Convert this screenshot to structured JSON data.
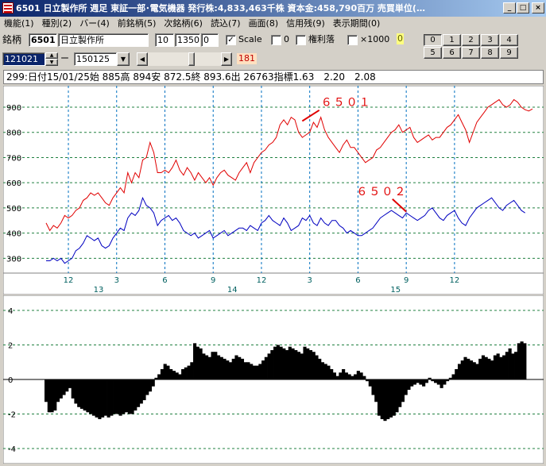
{
  "window": {
    "title": "6501 日立製作所 週足 東証一部･電気機器 発行株:4,833,463千株 資本金:458,790百万 売買単位(…",
    "min_glyph": "_",
    "max_glyph": "□",
    "close_glyph": "×"
  },
  "menu": [
    {
      "label": "機能(1)"
    },
    {
      "label": "種別(2)"
    },
    {
      "label": "バー(4)"
    },
    {
      "label": "前銘柄(5)"
    },
    {
      "label": "次銘柄(6)"
    },
    {
      "label": "読込(7)"
    },
    {
      "label": "画面(8)"
    },
    {
      "label": "信用残(9)"
    },
    {
      "label": "表示期間(0)"
    }
  ],
  "toolbar": {
    "code_label": "銘柄",
    "code": "6501",
    "name": "日立製作所",
    "param1": "10",
    "param2": "1350",
    "param3": "0",
    "scale_label": "Scale",
    "scale_checked": "✓",
    "zero_label": "0",
    "kenri_label": "権利落",
    "x1000_label": "×1000",
    "yellow_value": "0",
    "start_date": "121021",
    "dash": "ー",
    "end_date": "150125",
    "slider_value": "181",
    "num_buttons": [
      "0",
      "1",
      "2",
      "3",
      "4",
      "5",
      "6",
      "7",
      "8",
      "9"
    ],
    "selected_button": "0"
  },
  "info_line": "299:日付15/01/25始 885高 894安 872.5終 893.6出 26763指標1.63　2.20　2.08",
  "chart_data": [
    {
      "type": "line",
      "x_tick_labels": [
        "12",
        "3",
        "6",
        "9",
        "12",
        "3",
        "6",
        "9",
        "12"
      ],
      "year_labels": [
        "13",
        "14",
        "15"
      ],
      "y_ticks": [
        300,
        400,
        500,
        600,
        700,
        800,
        900
      ],
      "ylim": [
        260,
        960
      ],
      "grid": true,
      "series": [
        {
          "name": "6501",
          "color": "#e00000",
          "values": [
            440,
            410,
            430,
            420,
            440,
            470,
            460,
            470,
            490,
            500,
            530,
            540,
            560,
            550,
            560,
            540,
            520,
            510,
            540,
            560,
            580,
            560,
            640,
            600,
            640,
            620,
            690,
            700,
            760,
            720,
            640,
            640,
            650,
            640,
            660,
            690,
            650,
            630,
            660,
            640,
            610,
            640,
            620,
            600,
            620,
            590,
            620,
            640,
            650,
            630,
            620,
            610,
            640,
            660,
            680,
            640,
            680,
            700,
            720,
            730,
            750,
            760,
            780,
            830,
            850,
            830,
            860,
            850,
            800,
            780,
            790,
            800,
            840,
            820,
            860,
            810,
            780,
            760,
            740,
            720,
            750,
            770,
            740,
            740,
            720,
            700,
            680,
            690,
            700,
            730,
            740,
            760,
            780,
            800,
            810,
            830,
            800,
            810,
            820,
            780,
            760,
            770,
            780,
            790,
            770,
            780,
            780,
            800,
            820,
            830,
            850,
            870,
            840,
            810,
            760,
            800,
            840,
            860,
            880,
            900,
            910,
            920,
            930,
            910,
            900,
            910,
            930,
            920,
            900,
            890,
            885,
            893
          ]
        },
        {
          "name": "6502",
          "color": "#0000c0",
          "values": [
            290,
            290,
            300,
            290,
            300,
            280,
            290,
            300,
            330,
            340,
            360,
            390,
            380,
            370,
            380,
            350,
            340,
            350,
            380,
            400,
            420,
            410,
            460,
            480,
            470,
            490,
            540,
            510,
            500,
            480,
            430,
            450,
            460,
            470,
            450,
            460,
            440,
            410,
            400,
            390,
            400,
            380,
            390,
            400,
            410,
            380,
            390,
            400,
            410,
            390,
            400,
            410,
            420,
            420,
            410,
            430,
            420,
            410,
            440,
            450,
            470,
            450,
            440,
            430,
            460,
            440,
            410,
            420,
            430,
            460,
            450,
            470,
            440,
            430,
            460,
            440,
            430,
            450,
            450,
            430,
            420,
            400,
            410,
            400,
            390,
            390,
            400,
            410,
            420,
            440,
            460,
            470,
            480,
            490,
            480,
            470,
            460,
            480,
            470,
            460,
            450,
            460,
            470,
            490,
            500,
            480,
            460,
            450,
            470,
            480,
            490,
            460,
            440,
            430,
            460,
            480,
            500,
            510,
            520,
            530,
            540,
            520,
            500,
            490,
            510,
            520,
            530,
            510,
            490,
            480
          ]
        }
      ],
      "annotations": [
        {
          "text": "６５０１",
          "series": "6501"
        },
        {
          "text": "６５０２",
          "series": "6502"
        }
      ]
    },
    {
      "type": "bar",
      "y_ticks": [
        -4,
        -2,
        0,
        2,
        4
      ],
      "ylim": [
        -4.6,
        4.6
      ],
      "grid": true,
      "values": [
        -1.3,
        -1.9,
        -1.9,
        -1.8,
        -1.3,
        -1.1,
        -0.9,
        -0.7,
        -0.5,
        -1.1,
        -1.4,
        -1.6,
        -1.7,
        -1.8,
        -1.9,
        -2.0,
        -2.1,
        -2.2,
        -2.3,
        -2.2,
        -2.1,
        -2.2,
        -2.1,
        -2.0,
        -2.0,
        -2.1,
        -2.0,
        -1.9,
        -2.0,
        -2.0,
        -1.8,
        -1.6,
        -1.4,
        -1.2,
        -0.9,
        -0.7,
        -0.4,
        0.1,
        0.3,
        0.6,
        0.9,
        0.8,
        0.6,
        0.5,
        0.4,
        0.3,
        0.6,
        0.7,
        0.8,
        1.0,
        2.1,
        1.9,
        1.8,
        1.5,
        1.4,
        1.3,
        1.6,
        1.6,
        1.4,
        1.3,
        1.2,
        1.1,
        1.0,
        1.2,
        1.4,
        1.3,
        1.2,
        1.0,
        1.0,
        0.9,
        0.8,
        0.8,
        0.9,
        1.1,
        1.3,
        1.5,
        1.7,
        1.9,
        2.0,
        1.9,
        1.8,
        1.7,
        1.9,
        1.8,
        1.7,
        1.6,
        1.5,
        1.9,
        1.8,
        1.7,
        1.6,
        1.4,
        1.2,
        1.0,
        0.9,
        0.8,
        0.6,
        0.4,
        0.2,
        0.4,
        0.6,
        0.4,
        0.3,
        0.2,
        0.3,
        0.5,
        0.4,
        0.2,
        -0.1,
        -0.4,
        -0.9,
        -1.3,
        -2.1,
        -2.3,
        -2.4,
        -2.3,
        -2.2,
        -2.1,
        -1.9,
        -1.6,
        -1.3,
        -0.9,
        -0.6,
        -0.4,
        -0.3,
        -0.2,
        -0.3,
        -0.4,
        -0.2,
        0.1,
        -0.1,
        -0.2,
        -0.3,
        -0.5,
        -0.3,
        -0.1,
        0.1,
        0.3,
        0.6,
        0.9,
        1.1,
        1.3,
        1.2,
        1.1,
        1.0,
        0.9,
        1.2,
        1.4,
        1.3,
        1.2,
        1.1,
        1.4,
        1.5,
        1.3,
        1.4,
        1.6,
        1.8,
        1.5,
        1.6,
        2.1,
        2.2,
        2.1
      ]
    }
  ]
}
